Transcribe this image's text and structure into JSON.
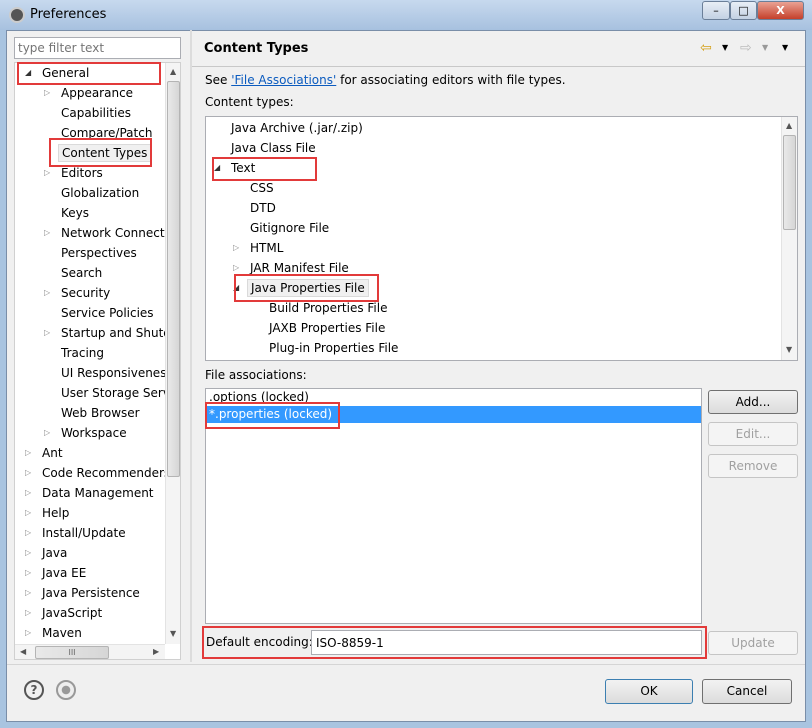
{
  "window": {
    "title": "Preferences",
    "minimize": "–",
    "maximize": "□",
    "close": "X"
  },
  "sidebar": {
    "filter_placeholder": "type filter text",
    "items": [
      {
        "label": "General",
        "level": 0,
        "state": "expanded"
      },
      {
        "label": "Appearance",
        "level": 1,
        "state": "collapsed"
      },
      {
        "label": "Capabilities",
        "level": 1,
        "state": "leaf"
      },
      {
        "label": "Compare/Patch",
        "level": 1,
        "state": "leaf"
      },
      {
        "label": "Content Types",
        "level": 1,
        "state": "leaf",
        "selected": true
      },
      {
        "label": "Editors",
        "level": 1,
        "state": "collapsed"
      },
      {
        "label": "Globalization",
        "level": 1,
        "state": "leaf"
      },
      {
        "label": "Keys",
        "level": 1,
        "state": "leaf"
      },
      {
        "label": "Network Connections",
        "level": 1,
        "state": "collapsed"
      },
      {
        "label": "Perspectives",
        "level": 1,
        "state": "leaf"
      },
      {
        "label": "Search",
        "level": 1,
        "state": "leaf"
      },
      {
        "label": "Security",
        "level": 1,
        "state": "collapsed"
      },
      {
        "label": "Service Policies",
        "level": 1,
        "state": "leaf"
      },
      {
        "label": "Startup and Shutdown",
        "level": 1,
        "state": "collapsed"
      },
      {
        "label": "Tracing",
        "level": 1,
        "state": "leaf"
      },
      {
        "label": "UI Responsiveness",
        "level": 1,
        "state": "leaf"
      },
      {
        "label": "User Storage Service",
        "level": 1,
        "state": "leaf"
      },
      {
        "label": "Web Browser",
        "level": 1,
        "state": "leaf"
      },
      {
        "label": "Workspace",
        "level": 1,
        "state": "collapsed"
      },
      {
        "label": "Ant",
        "level": 0,
        "state": "collapsed"
      },
      {
        "label": "Code Recommenders",
        "level": 0,
        "state": "collapsed"
      },
      {
        "label": "Data Management",
        "level": 0,
        "state": "collapsed"
      },
      {
        "label": "Help",
        "level": 0,
        "state": "collapsed"
      },
      {
        "label": "Install/Update",
        "level": 0,
        "state": "collapsed"
      },
      {
        "label": "Java",
        "level": 0,
        "state": "collapsed"
      },
      {
        "label": "Java EE",
        "level": 0,
        "state": "collapsed"
      },
      {
        "label": "Java Persistence",
        "level": 0,
        "state": "collapsed"
      },
      {
        "label": "JavaScript",
        "level": 0,
        "state": "collapsed"
      },
      {
        "label": "Maven",
        "level": 0,
        "state": "collapsed"
      }
    ],
    "hscroll_grip": "III"
  },
  "page": {
    "title": "Content Types",
    "see_prefix": "See ",
    "see_link": "'File Associations'",
    "see_suffix": " for associating editors with file types.",
    "content_types_label": "Content types:",
    "content_types": [
      {
        "label": "Java Archive (.jar/.zip)",
        "level": 0,
        "state": "leaf"
      },
      {
        "label": "Java Class File",
        "level": 0,
        "state": "leaf"
      },
      {
        "label": "Text",
        "level": 0,
        "state": "expanded"
      },
      {
        "label": "CSS",
        "level": 1,
        "state": "leaf"
      },
      {
        "label": "DTD",
        "level": 1,
        "state": "leaf"
      },
      {
        "label": "Gitignore File",
        "level": 1,
        "state": "leaf"
      },
      {
        "label": "HTML",
        "level": 1,
        "state": "collapsed"
      },
      {
        "label": "JAR Manifest File",
        "level": 1,
        "state": "collapsed"
      },
      {
        "label": "Java Properties File",
        "level": 1,
        "state": "expanded",
        "selected": true
      },
      {
        "label": "Build Properties File",
        "level": 2,
        "state": "leaf"
      },
      {
        "label": "JAXB Properties File",
        "level": 2,
        "state": "leaf"
      },
      {
        "label": "Plug-in Properties File",
        "level": 2,
        "state": "leaf"
      }
    ],
    "file_assoc_label": "File associations:",
    "file_assocs": [
      {
        "label": ".options (locked)",
        "selected": false
      },
      {
        "label": "*.properties (locked)",
        "selected": true
      }
    ],
    "add_label": "Add...",
    "edit_label": "Edit...",
    "remove_label": "Remove",
    "encoding_label": "Default encoding:",
    "encoding_value": "ISO-8859-1",
    "update_label": "Update"
  },
  "footer": {
    "ok_label": "OK",
    "cancel_label": "Cancel"
  },
  "colors": {
    "selection": "#3399ff",
    "highlight_box": "#e23a3a",
    "link": "#0b5bbf"
  }
}
